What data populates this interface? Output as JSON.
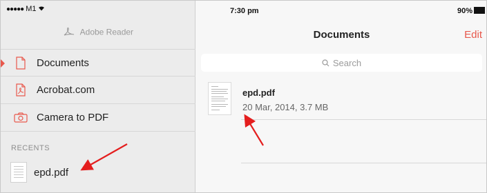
{
  "status": {
    "carrier": "M1",
    "time": "7:30 pm",
    "battery": "90%"
  },
  "sidebar": {
    "brand": "Adobe Reader",
    "items": [
      {
        "label": "Documents",
        "icon": "document-icon"
      },
      {
        "label": "Acrobat.com",
        "icon": "acrobat-icon"
      },
      {
        "label": "Camera to PDF",
        "icon": "camera-icon"
      }
    ],
    "recents_header": "RECENTS",
    "recents": [
      {
        "label": "epd.pdf",
        "icon": "pdf-thumbnail-icon"
      }
    ]
  },
  "main": {
    "title": "Documents",
    "edit_label": "Edit",
    "search_placeholder": "Search",
    "documents": [
      {
        "name": "epd.pdf",
        "meta": "20 Mar, 2014, 3.7 MB"
      }
    ]
  },
  "colors": {
    "accent": "#e8584c",
    "annotation_arrow": "#e41e1e"
  }
}
